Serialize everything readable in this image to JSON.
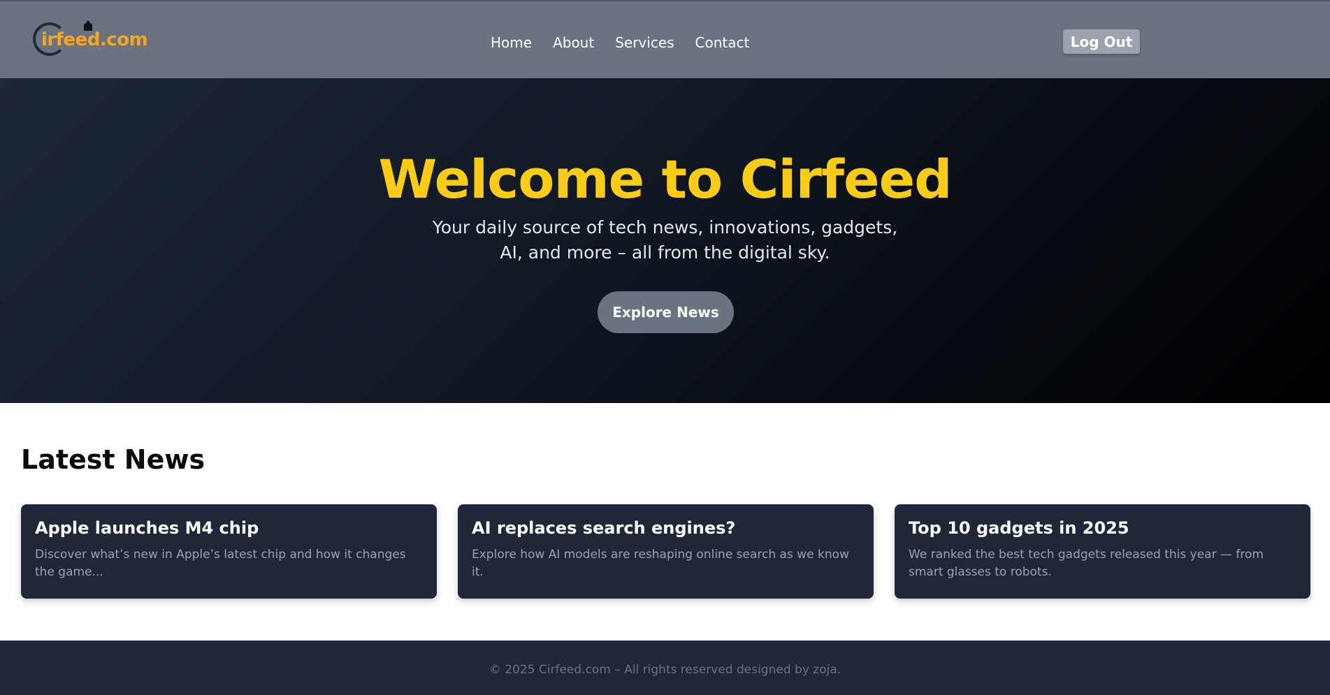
{
  "brand": {
    "logo_text": "irfeed.com",
    "accent": "#f5a623"
  },
  "nav": {
    "links": [
      "Home",
      "About",
      "Services",
      "Contact"
    ],
    "logout": "Log Out"
  },
  "hero": {
    "title": "Welcome to Cirfeed",
    "subtitle": "Your daily source of tech news, innovations, gadgets, AI, and more – all from the digital sky.",
    "cta": "Explore News",
    "title_color": "#facc15"
  },
  "news": {
    "heading": "Latest News",
    "cards": [
      {
        "title": "Apple launches M4 chip",
        "text": "Discover what’s new in Apple’s latest chip and how it changes the game..."
      },
      {
        "title": "AI replaces search engines?",
        "text": "Explore how AI models are reshaping online search as we know it."
      },
      {
        "title": "Top 10 gadgets in 2025",
        "text": "We ranked the best tech gadgets released this year — from smart glasses to robots."
      }
    ]
  },
  "footer": {
    "text": "© 2025 Cirfeed.com – All rights reserved designed by zoja."
  }
}
